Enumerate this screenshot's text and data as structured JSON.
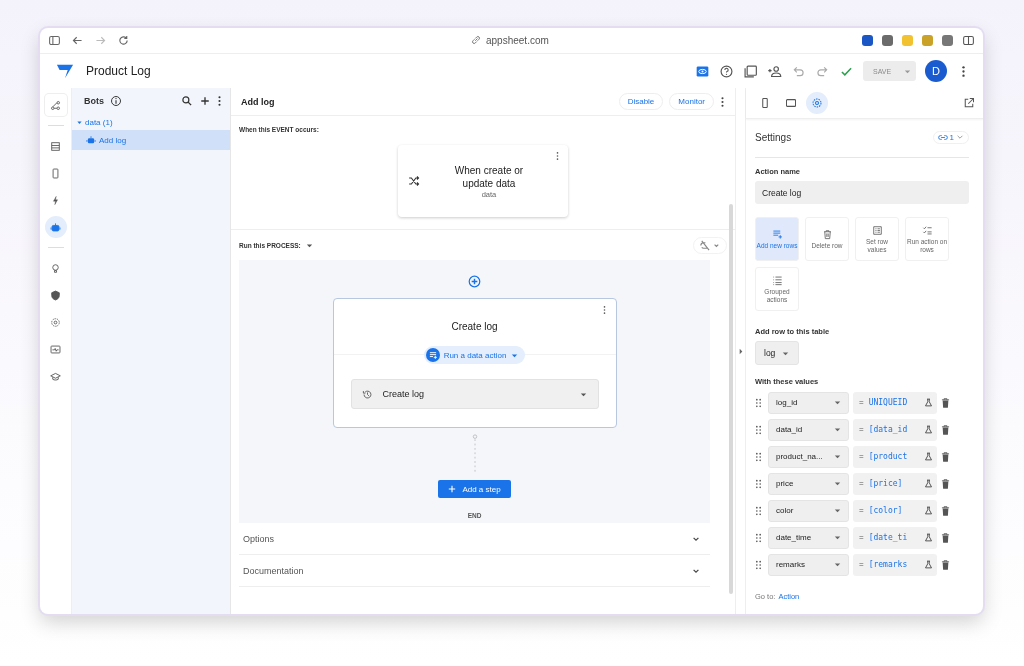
{
  "browser": {
    "url": "appsheet.com",
    "extensions": [
      {
        "color": "#1a56c4"
      },
      {
        "color": "#6b6b6b"
      },
      {
        "color": "#f2c230"
      },
      {
        "color": "#c9a227"
      },
      {
        "color": "#777777"
      }
    ]
  },
  "app": {
    "title": "Product Log",
    "save_label": "SAVE",
    "avatar": "D"
  },
  "rail": [
    {
      "kind": "flow",
      "selected": false
    },
    {
      "kind": "table",
      "selected": false
    },
    {
      "kind": "phone",
      "selected": false
    },
    {
      "kind": "bolt",
      "selected": false
    },
    {
      "kind": "bot",
      "selected": true
    },
    {
      "kind": "bulb",
      "selected": false
    },
    {
      "kind": "shield",
      "selected": false
    },
    {
      "kind": "gear",
      "selected": false
    },
    {
      "kind": "monitor",
      "selected": false
    },
    {
      "kind": "cap",
      "selected": false
    }
  ],
  "bots_panel": {
    "title": "Bots",
    "groups": [
      {
        "label": "data (1)",
        "expanded": true,
        "children": [
          {
            "label": "Add log",
            "selected": true
          }
        ]
      }
    ]
  },
  "editor": {
    "title": "Add log",
    "buttons": [
      "Disable",
      "Monitor"
    ],
    "event_heading": "When this EVENT occurs:",
    "event": {
      "title": "When create or update data",
      "table": "data"
    },
    "process_heading": "Run this PROCESS:",
    "step": {
      "title": "Create log",
      "type_chip": "Run a data action",
      "action": "Create log"
    },
    "add_step": "Add a step",
    "end": "END",
    "sections": [
      "Options",
      "Documentation"
    ]
  },
  "settings": {
    "tabs": [
      {
        "kind": "phone",
        "selected": false
      },
      {
        "kind": "tablet",
        "selected": false
      },
      {
        "kind": "gear",
        "selected": true
      }
    ],
    "title": "Settings",
    "link_count": "1",
    "action_name_label": "Action name",
    "action_name": "Create log",
    "action_types": [
      {
        "label": "Add new rows",
        "kind": "add",
        "selected": true
      },
      {
        "label": "Delete row",
        "kind": "delete",
        "selected": false
      },
      {
        "label": "Set row values",
        "kind": "set",
        "selected": false
      },
      {
        "label": "Run action on rows",
        "kind": "run",
        "selected": false
      },
      {
        "label": "Grouped actions",
        "kind": "group",
        "selected": false
      }
    ],
    "table_label": "Add row to this table",
    "table": "log",
    "values_label": "With these values",
    "values": [
      {
        "column": "log_id",
        "operator": "=",
        "expression": "UNIQUEID"
      },
      {
        "column": "data_id",
        "operator": "=",
        "expression": "[data_id"
      },
      {
        "column": "product_na...",
        "operator": "=",
        "expression": "[product"
      },
      {
        "column": "price",
        "operator": "=",
        "expression": "[price]"
      },
      {
        "column": "color",
        "operator": "=",
        "expression": "[color]"
      },
      {
        "column": "date_time",
        "operator": "=",
        "expression": "[date_ti"
      },
      {
        "column": "remarks",
        "operator": "=",
        "expression": "[remarks"
      }
    ],
    "goto_label": "Go to:",
    "goto_link": "Action"
  }
}
